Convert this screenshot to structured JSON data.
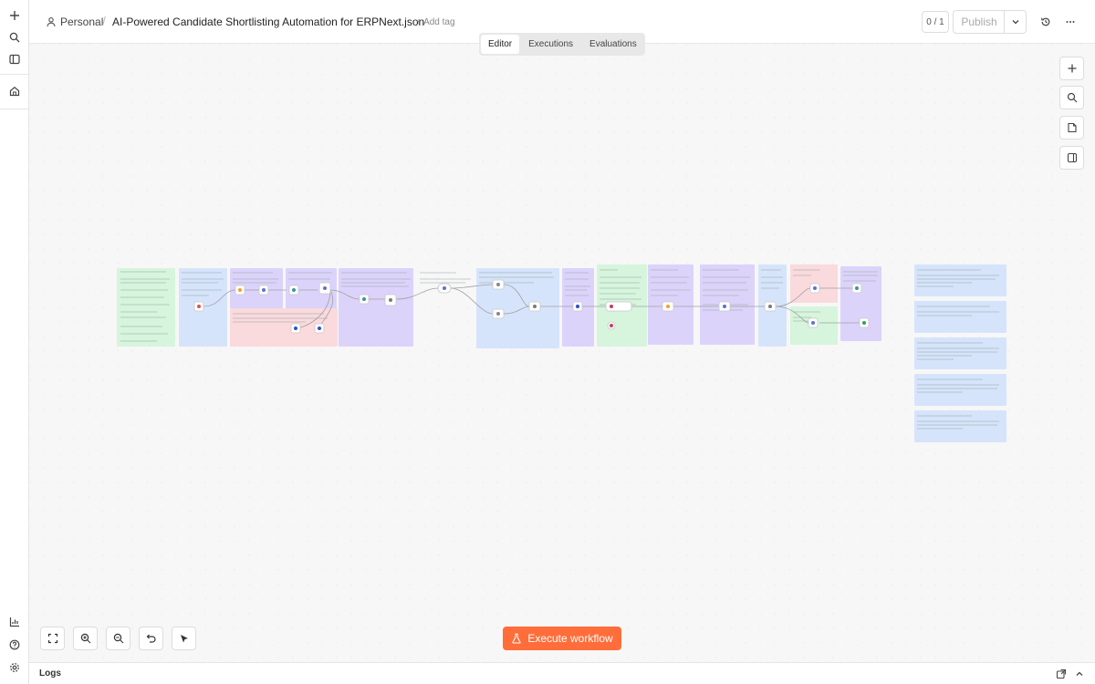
{
  "header": {
    "owner": "Personal",
    "workflow_name": "AI-Powered Candidate Shortlisting Automation for ERPNext.json",
    "add_tag": "+ Add tag",
    "counter": "0 / 1",
    "publish": "Publish"
  },
  "tabs": [
    {
      "label": "Editor",
      "active": true
    },
    {
      "label": "Executions",
      "active": false
    },
    {
      "label": "Evaluations",
      "active": false
    }
  ],
  "left_rail": {
    "top_icons": [
      "plus-icon",
      "search-icon",
      "sidebar-icon",
      "home-icon"
    ],
    "bottom_icons": [
      "insights-icon",
      "help-icon",
      "settings-icon"
    ]
  },
  "right_tools": [
    "plus-icon",
    "search-icon",
    "sticky-note-icon",
    "panel-icon"
  ],
  "bottom_tools": [
    "fit-view-icon",
    "zoom-in-icon",
    "zoom-out-icon",
    "undo-icon",
    "tidy-up-icon"
  ],
  "execute_button": "Execute workflow",
  "logs": {
    "label": "Logs",
    "icons": [
      "popout-icon",
      "chevron-up-icon"
    ]
  },
  "colors": {
    "accent": "#ff6d3a",
    "canvas": "#f7f7f7",
    "sticky_green": "#d6f5dc",
    "sticky_blue": "#d6e4fb",
    "sticky_purple": "#dcd3fb",
    "sticky_red": "#fadadd"
  }
}
